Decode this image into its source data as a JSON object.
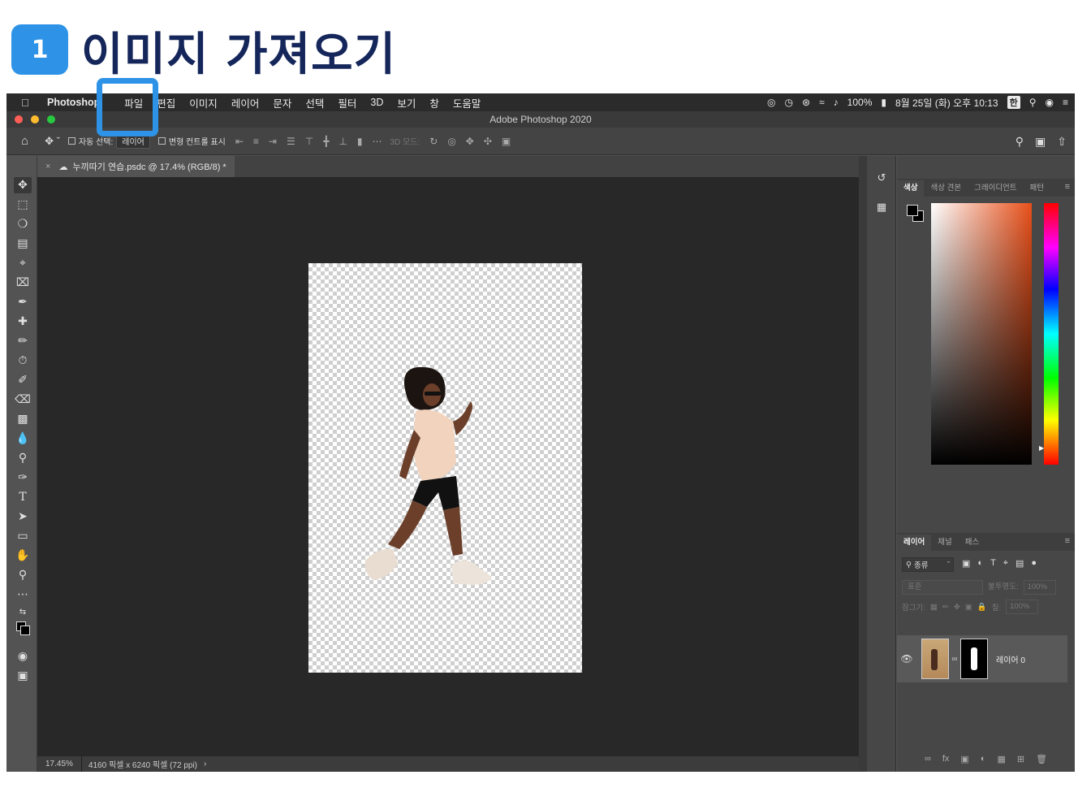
{
  "heading": {
    "step": "1",
    "title": "이미지 가져오기"
  },
  "menubar": {
    "app_name": "Photoshop",
    "items": [
      "파일",
      "편집",
      "이미지",
      "레이어",
      "문자",
      "선택",
      "필터",
      "3D",
      "보기",
      "창",
      "도움말"
    ],
    "battery": "100%",
    "datetime": "8월 25일 (화) 오후 10:13",
    "input_method": "한"
  },
  "window": {
    "title": "Adobe Photoshop 2020"
  },
  "options_bar": {
    "auto_select_label": "자동 선택:",
    "auto_select_value": "레이어",
    "transform_controls_label": "변형 컨트롤 표시",
    "mode_3d_label": "3D 모드:"
  },
  "document": {
    "tab_title": "누끼따기 연습.psdc @ 17.4% (RGB/8) *"
  },
  "status_bar": {
    "zoom": "17.45%",
    "dimensions": "4160 픽셀 x 6240 픽셀 (72 ppi)"
  },
  "color_panel": {
    "tabs": [
      "색상",
      "색상 견본",
      "그레이디언트",
      "패턴"
    ],
    "foreground": "#000000",
    "background": "#000000"
  },
  "layers_panel": {
    "tabs": [
      "레이어",
      "채널",
      "패스"
    ],
    "filter_label": "종류",
    "blend_mode": "표준",
    "opacity_label": "불투명도:",
    "opacity_value": "100%",
    "lock_label": "잠그기:",
    "fill_label": "칠:",
    "fill_value": "100%",
    "layers": [
      {
        "name": "레이어 0"
      }
    ]
  },
  "colors": {
    "highlight": "#2e93e6",
    "title_text": "#15265b"
  }
}
